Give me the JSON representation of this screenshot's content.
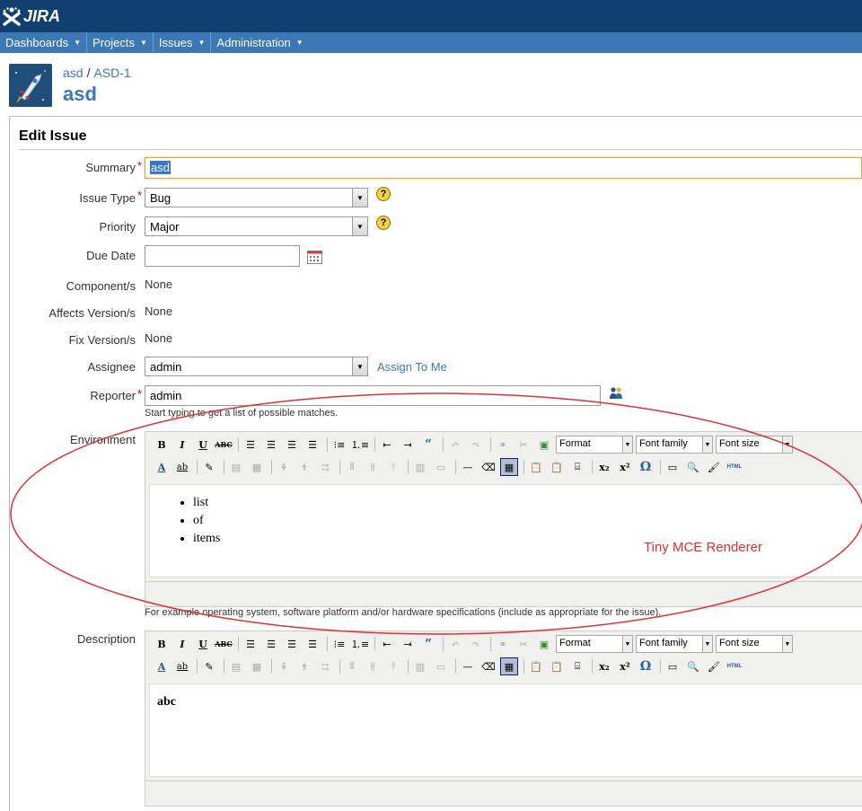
{
  "header": {
    "logo_text": "JIRA"
  },
  "nav": {
    "items": [
      {
        "label": "Dashboards"
      },
      {
        "label": "Projects"
      },
      {
        "label": "Issues"
      },
      {
        "label": "Administration"
      }
    ]
  },
  "breadcrumb": {
    "project": "asd",
    "issue_key": "ASD-1"
  },
  "issue": {
    "title": "asd"
  },
  "panel": {
    "title": "Edit Issue"
  },
  "form": {
    "summary": {
      "label": "Summary",
      "value": "asd"
    },
    "issue_type": {
      "label": "Issue Type",
      "value": "Bug"
    },
    "priority": {
      "label": "Priority",
      "value": "Major"
    },
    "due_date": {
      "label": "Due Date",
      "value": ""
    },
    "components": {
      "label": "Component/s",
      "value": "None"
    },
    "affects_versions": {
      "label": "Affects Version/s",
      "value": "None"
    },
    "fix_versions": {
      "label": "Fix Version/s",
      "value": "None"
    },
    "assignee": {
      "label": "Assignee",
      "value": "admin",
      "assign_link": "Assign To Me"
    },
    "reporter": {
      "label": "Reporter",
      "value": "admin",
      "hint": "Start typing to get a list of possible matches."
    },
    "environment": {
      "label": "Environment",
      "list_items": [
        "list",
        "of",
        "items"
      ],
      "hint": "For example operating system, software platform and/or hardware specifications (include as appropriate for the issue)."
    },
    "description": {
      "label": "Description",
      "content": "abc"
    }
  },
  "toolbar": {
    "format": "Format",
    "font_family": "Font family",
    "font_size": "Font size",
    "html_label": "HTML"
  },
  "annotation": {
    "text": "Tiny MCE Renderer",
    "color": "#e03030"
  },
  "colors": {
    "header": "#114070",
    "nav": "#3c78b5",
    "link": "#3c78b5"
  }
}
